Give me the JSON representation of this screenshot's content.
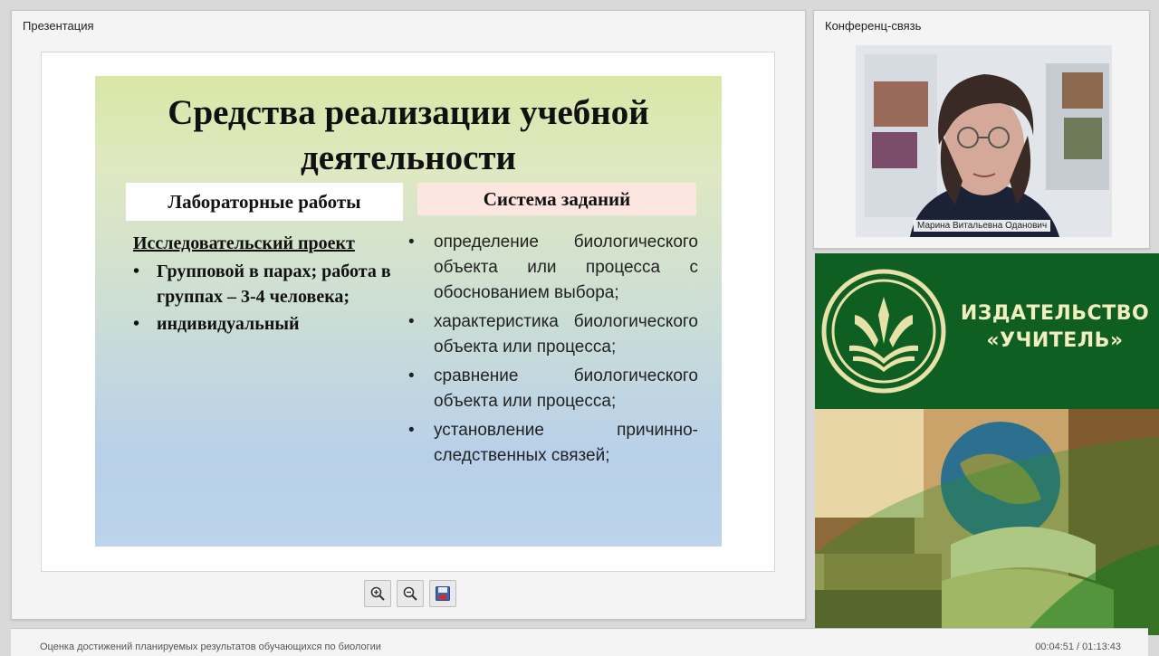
{
  "presentation_panel": {
    "title": "Презентация"
  },
  "slide": {
    "title_line1": "Средства реализации учебной",
    "title_line2": "деятельности",
    "left_header": "Лабораторные работы",
    "right_header": "Система заданий",
    "project_title": "Исследовательский проект",
    "left_items": [
      "Групповой  в парах; работа в группах – 3-4 человека;",
      "индивидуальный"
    ],
    "right_items": [
      "определение биологического объекта или процесса с обоснованием выбора;",
      "характеристика биологического объекта или процесса;",
      "сравнение биологического объекта или процесса;",
      "установление причинно-следственных связей;"
    ],
    "bullet": "•"
  },
  "toolbar": {
    "zoom_in_icon": "zoom-in-icon",
    "zoom_out_icon": "zoom-out-icon",
    "save_icon": "save-icon"
  },
  "conference_panel": {
    "title": "Конференц-связь",
    "speaker_name": "Марина Витальевна Оданович"
  },
  "publisher_banner": {
    "name_line1": "ИЗДАТЕЛЬСТВО",
    "name_line2": "«УЧИТЕЛЬ»"
  },
  "footer": {
    "course_title": "Оценка достижений планируемых результатов обучающихся по биологии",
    "time": "00:04:51 / 01:13:43"
  },
  "colors": {
    "publisher_green": "#0f5f22",
    "publisher_text": "#f1efc0",
    "right_header_bg": "#fce6df"
  }
}
